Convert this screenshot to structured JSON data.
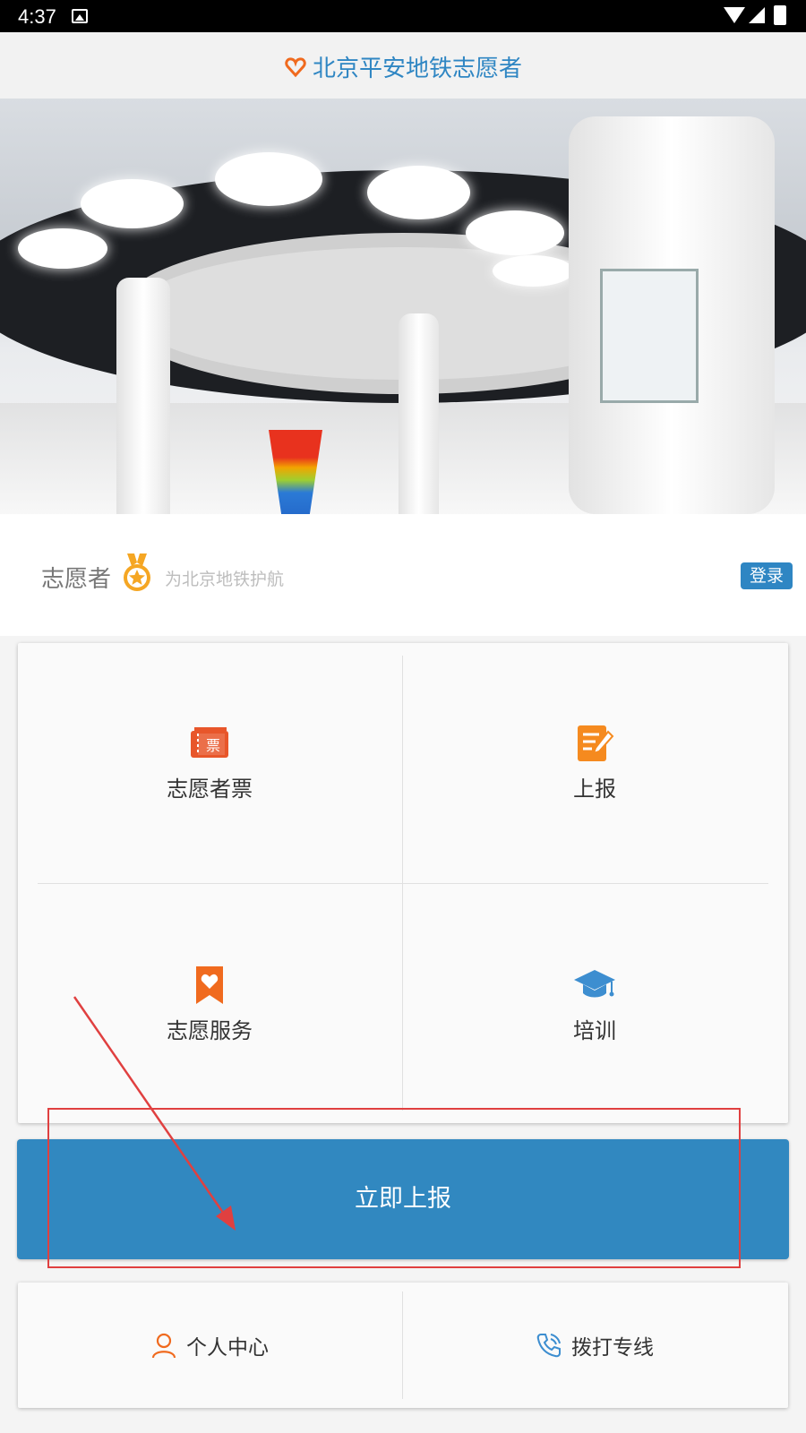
{
  "status_bar": {
    "time": "4:37"
  },
  "header": {
    "title": "北京平安地铁志愿者"
  },
  "banner": {
    "dots_count": 2,
    "active_dot": 0
  },
  "volunteer": {
    "label": "志愿者",
    "slogan": "为北京地铁护航",
    "login_label": "登录"
  },
  "grid": {
    "items": [
      {
        "label": "志愿者票",
        "icon": "ticket-icon",
        "badge_text": "票"
      },
      {
        "label": "上报",
        "icon": "report-edit-icon"
      },
      {
        "label": "志愿服务",
        "icon": "bookmark-heart-icon"
      },
      {
        "label": "培训",
        "icon": "graduation-cap-icon"
      }
    ]
  },
  "report_button": {
    "label": "立即上报"
  },
  "bottom": {
    "personal_center": {
      "label": "个人中心",
      "icon": "person-icon"
    },
    "hotline": {
      "label": "拨打专线",
      "icon": "phone-icon"
    }
  },
  "colors": {
    "brand_blue": "#3188c0",
    "orange": "#f06a1e",
    "annotation_red": "#e04040"
  }
}
